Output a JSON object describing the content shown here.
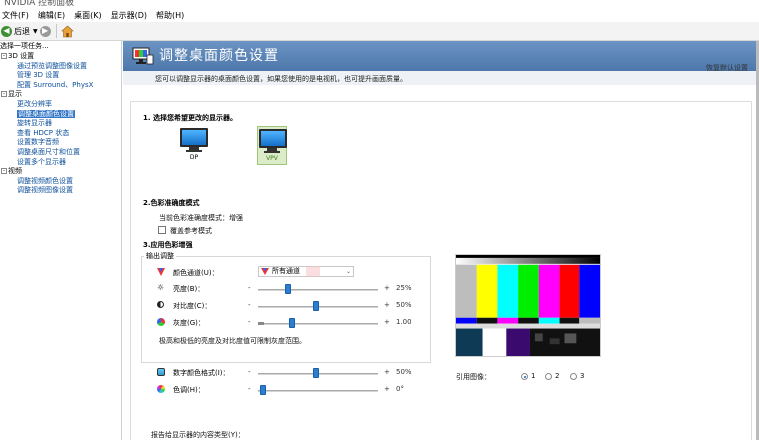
{
  "window": {
    "title": "NVIDIA 控制面板"
  },
  "menu": [
    "文件(F)",
    "编辑(E)",
    "桌面(K)",
    "显示器(D)",
    "帮助(H)"
  ],
  "toolbar": {
    "back_label": "后退"
  },
  "left": {
    "task_header": "选择一项任务...",
    "tree": [
      {
        "type": "cat",
        "label": "3D 设置"
      },
      {
        "type": "item",
        "label": "通过预览调整图像设置"
      },
      {
        "type": "item",
        "label": "管理 3D 设置"
      },
      {
        "type": "item",
        "label": "配置 Surround、PhysX"
      },
      {
        "type": "cat",
        "label": "显示"
      },
      {
        "type": "item",
        "label": "更改分辨率"
      },
      {
        "type": "item",
        "label": "调整桌面颜色设置",
        "selected": true
      },
      {
        "type": "item",
        "label": "旋转显示器"
      },
      {
        "type": "item",
        "label": "查看 HDCP 状态"
      },
      {
        "type": "item",
        "label": "设置数字音频"
      },
      {
        "type": "item",
        "label": "调整桌面尺寸和位置"
      },
      {
        "type": "item",
        "label": "设置多个显示器"
      },
      {
        "type": "cat",
        "label": "视频"
      },
      {
        "type": "item",
        "label": "调整视频颜色设置"
      },
      {
        "type": "item",
        "label": "调整视频图像设置"
      }
    ]
  },
  "page": {
    "title": "调整桌面颜色设置",
    "restore_link": "恢复默认设置",
    "description": "您可以调整显示器的桌面颜色设置，如果您使用的是电视机，也可提升画面质量。"
  },
  "section1": {
    "heading": "1. 选择您希望更改的显示器。",
    "displays": [
      {
        "label": "DP",
        "selected": false
      },
      {
        "label": "VPV",
        "selected": true
      }
    ]
  },
  "section2": {
    "heading": "2.色彩准确度模式",
    "current_mode": "当前色彩准确度模式：增强",
    "override_label": "覆盖参考模式"
  },
  "section3": {
    "heading": "3.应用色彩增强",
    "group_title": "输出调整",
    "channel_label": "颜色通道(U)：",
    "channel_value": "所有通道",
    "brightness": {
      "label": "亮度(B)：",
      "value": "25%",
      "level": 0.25
    },
    "contrast": {
      "label": "对比度(C)：",
      "value": "50%",
      "level": 0.5
    },
    "gamma": {
      "label": "灰度(G)：",
      "value": "1.00",
      "level": 0.27
    },
    "note": "极高和极低的亮度及对比度值可限制灰度范围。",
    "vibrance": {
      "label": "数字颜色格式(I)：",
      "value": "50%",
      "level": 0.5
    },
    "hue": {
      "label": "色调(H)：",
      "value": "0°",
      "level": 0.0
    },
    "minus": "-",
    "plus": "+"
  },
  "reference": {
    "label": "引用图像：",
    "options": [
      "1",
      "2",
      "3"
    ],
    "selected": "1"
  },
  "footer_text": "报告给显示器的内容类型(Y)：",
  "colors": {
    "banner": "#5a83b8",
    "link": "#0b4e9a",
    "selection": "#3176c6",
    "slider_thumb": "#2a7fd4"
  }
}
